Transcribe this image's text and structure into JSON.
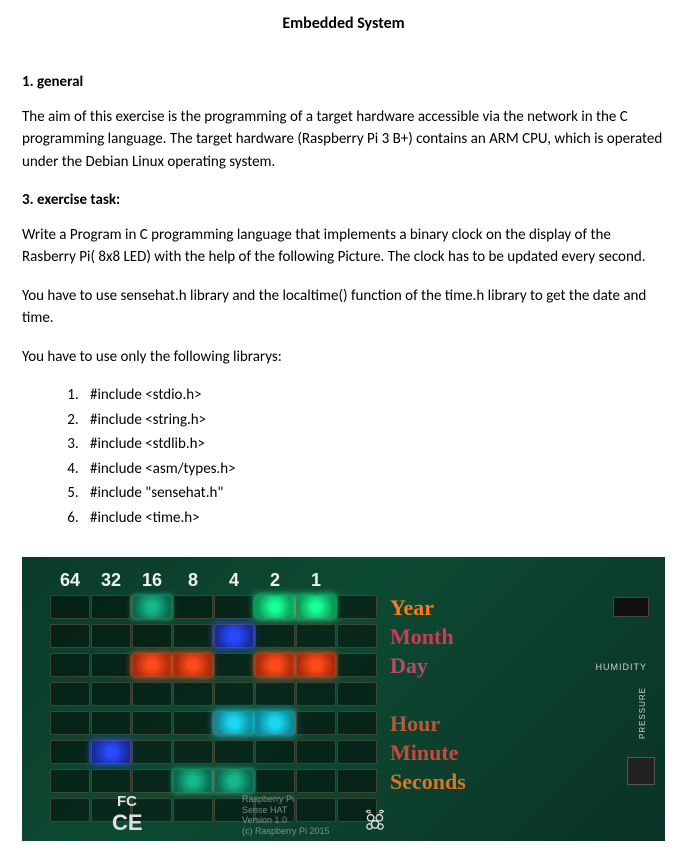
{
  "title": "Embedded System",
  "sections": {
    "general": {
      "heading": "1. general",
      "text": "The aim of this exercise is the programming of a target hardware accessible via the network in the C programming language. The target hardware (Raspberry Pi 3 B+) contains an ARM CPU, which is operated under the Debian Linux operating system."
    },
    "task": {
      "heading": "3. exercise task:",
      "p1": "Write a Program in C programming language that implements a binary clock on the display of the Rasberry Pi( 8x8 LED) with the help of the following Picture. The clock has to be updated every second.",
      "p2": "You have to use  sensehat.h library and the localtime() function of the time.h library to get the date and time.",
      "p3": "You have to use only the following librarys:"
    }
  },
  "libraries": [
    "#include <stdio.h>",
    "#include <string.h>",
    "#include <stdlib.h>",
    "#include <asm/types.h>",
    "#include \"sensehat.h\"",
    "#include <time.h>"
  ],
  "board": {
    "headers": [
      "64",
      "32",
      "16",
      "8",
      "4",
      "2",
      "1",
      ""
    ],
    "row_labels": [
      "Year",
      "Month",
      "Day",
      "",
      "Hour",
      "Minute",
      "Seconds",
      ""
    ],
    "board_text_1": "Raspberry Pi",
    "board_text_2": "Sense HAT",
    "board_text_3": "Version 1.0",
    "board_text_4": "(c) Raspberry Pi 2015",
    "fc": "FC",
    "ce": "CE",
    "humidity": "HUMIDITY",
    "pressure": "PRESSURE"
  },
  "led_state": [
    [
      "off",
      "off",
      "teal",
      "off",
      "off",
      "green",
      "green",
      "off"
    ],
    [
      "off",
      "off",
      "off",
      "off",
      "blue",
      "off",
      "off",
      "off"
    ],
    [
      "off",
      "off",
      "redorange",
      "redorange",
      "off",
      "redorange",
      "redorange",
      "off"
    ],
    [
      "off",
      "off",
      "off",
      "off",
      "off",
      "off",
      "off",
      "off"
    ],
    [
      "off",
      "off",
      "off",
      "off",
      "cyan",
      "cyan",
      "off",
      "off"
    ],
    [
      "off",
      "blue",
      "off",
      "off",
      "off",
      "off",
      "off",
      "off"
    ],
    [
      "off",
      "off",
      "off",
      "teal",
      "teal",
      "off",
      "off",
      "off"
    ],
    [
      "off",
      "off",
      "off",
      "off",
      "off",
      "off",
      "off",
      "off"
    ]
  ]
}
